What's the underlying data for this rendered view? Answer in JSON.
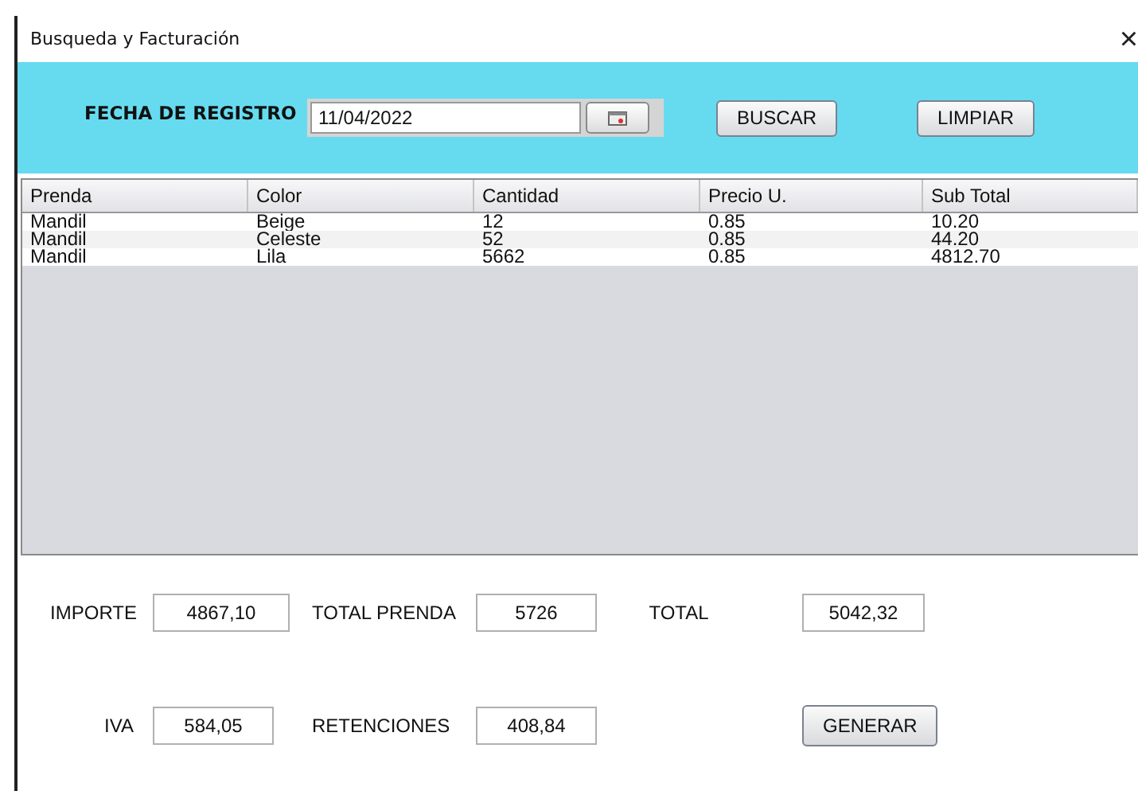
{
  "window": {
    "title": "Busqueda y Facturación",
    "close": "×"
  },
  "search": {
    "label": "FECHA DE REGISTRO",
    "date": "11/04/2022",
    "buttons": [
      "BUSCAR",
      "LIMPIAR"
    ]
  },
  "table": {
    "columns": [
      "Prenda",
      "Color",
      "Cantidad",
      "Precio U.",
      "Sub Total"
    ],
    "rows": [
      [
        "Mandil",
        "Beige",
        "12",
        "0.85",
        "10.20"
      ],
      [
        "Mandil",
        "Celeste",
        "52",
        "0.85",
        "44.20"
      ],
      [
        "Mandil",
        "Lila",
        "5662",
        "0.85",
        "4812.70"
      ]
    ]
  },
  "totals": [
    {
      "label": "IMPORTE",
      "value": "4867,10"
    },
    {
      "label": "TOTAL PRENDA",
      "value": "5726"
    },
    {
      "label": "TOTAL",
      "value": "5042,32"
    },
    {
      "label": "IVA",
      "value": "584,05"
    },
    {
      "label": "RETENCIONES",
      "value": "408,84"
    }
  ],
  "generate_button": "GENERAR"
}
